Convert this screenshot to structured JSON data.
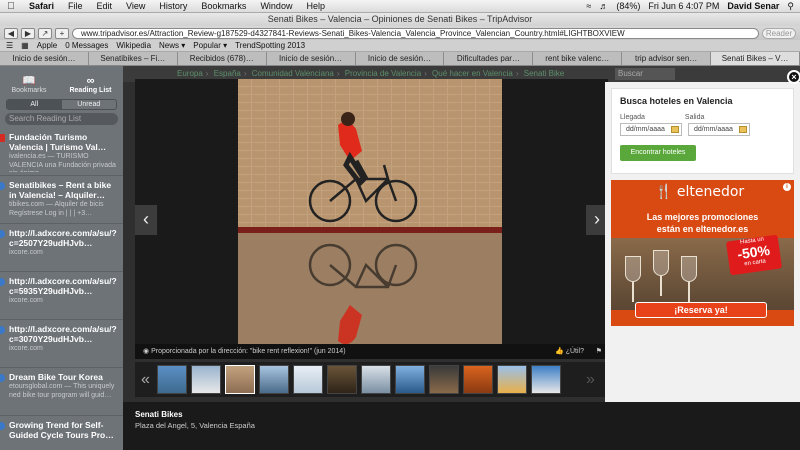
{
  "menubar": {
    "apple": "",
    "app": "Safari",
    "items": [
      "File",
      "Edit",
      "View",
      "History",
      "Bookmarks",
      "Window",
      "Help"
    ],
    "battery": "(84%)",
    "datetime": "Fri Jun 6  4:07 PM",
    "user": "David Senar"
  },
  "window": {
    "title": "Senati Bikes – Valencia – Opiniones de Senati Bikes – TripAdvisor"
  },
  "toolbar": {
    "url": "www.tripadvisor.es/Attraction_Review-g187529-d4327841-Reviews-Senati_Bikes-Valencia_Valencia_Province_Valencian_Country.html#LIGHTBOXVIEW",
    "reader": "Reader"
  },
  "bookmarks": [
    "Apple",
    "0 Messages",
    "Wikipedia",
    "News ▾",
    "Popular ▾",
    "TrendSpotting 2013"
  ],
  "tabs": [
    "Inicio de sesión…",
    "Senatibikes – Fi…",
    "Recibidos (678)…",
    "Inicio de sesión…",
    "Inicio de sesión…",
    "Dificultades par…",
    "rent bike valenc…",
    "trip advisor sen…",
    "Senati Bikes – V…"
  ],
  "sidebar": {
    "bookmarks_label": "Bookmarks",
    "reading_list_label": "Reading List",
    "filter_all": "All",
    "filter_unread": "Unread",
    "search_placeholder": "Search Reading List",
    "items": [
      {
        "title": "Fundación Turismo Valencia | Turismo Val…",
        "desc": "ivalencia.es — TURISMO VALENCIA una Fundación privada sin ánimo…",
        "icon": "red"
      },
      {
        "title": "Senatibikes – Rent a bike in Valencia! – Alquiler…",
        "desc": "tibikes.com — Alquiler de bicis Regístrese Log in | | | +3…",
        "icon": "blue"
      },
      {
        "title": "http://l.adxcore.com/a/su/?c=2507Y29udHJvb…",
        "desc": "ixcore.com",
        "icon": "blue"
      },
      {
        "title": "http://l.adxcore.com/a/su/?c=5935Y29udHJvb…",
        "desc": "ixcore.com",
        "icon": "blue"
      },
      {
        "title": "http://l.adxcore.com/a/su/?c=3070Y29udHJvb…",
        "desc": "ixcore.com",
        "icon": "blue"
      },
      {
        "title": "Dream Bike Tour Korea",
        "desc": "etoursglobal.com — This uniquely ned bike tour program will guid…",
        "icon": "blue"
      },
      {
        "title": "Growing Trend for Self-Guided Cycle Tours Pro…",
        "desc": "",
        "icon": "blue"
      }
    ]
  },
  "page": {
    "breadcrumbs": [
      "Europa",
      "España",
      "Comunidad Valenciana",
      "Provincia de Valencia",
      "Qué hacer en Valencia",
      "Senati Bike"
    ],
    "search_placeholder": "Buscar",
    "caption": "Proporcionada por la dirección: \"bike rent reflexion!\" (jun 2014)",
    "like": "¿Útil?",
    "business_name": "Senati Bikes",
    "business_address": "Plaza del Angel, 5, Valencia España",
    "hotel_search": {
      "title": "Busca hoteles en Valencia",
      "checkin_label": "Llegada",
      "checkout_label": "Salida",
      "checkin_placeholder": "dd/mm/aaaa",
      "checkout_placeholder": "dd/mm/aaaa",
      "button": "Encontrar hoteles"
    },
    "ad": {
      "logo": "eltenedor",
      "line1": "Las mejores promociones",
      "line2": "están en eltenedor.es",
      "badge_small": "Hasta un",
      "badge_big": "-50%",
      "badge_small2": "en carta",
      "cta": "¡Reserva ya!",
      "info": "i"
    },
    "close": "×"
  }
}
